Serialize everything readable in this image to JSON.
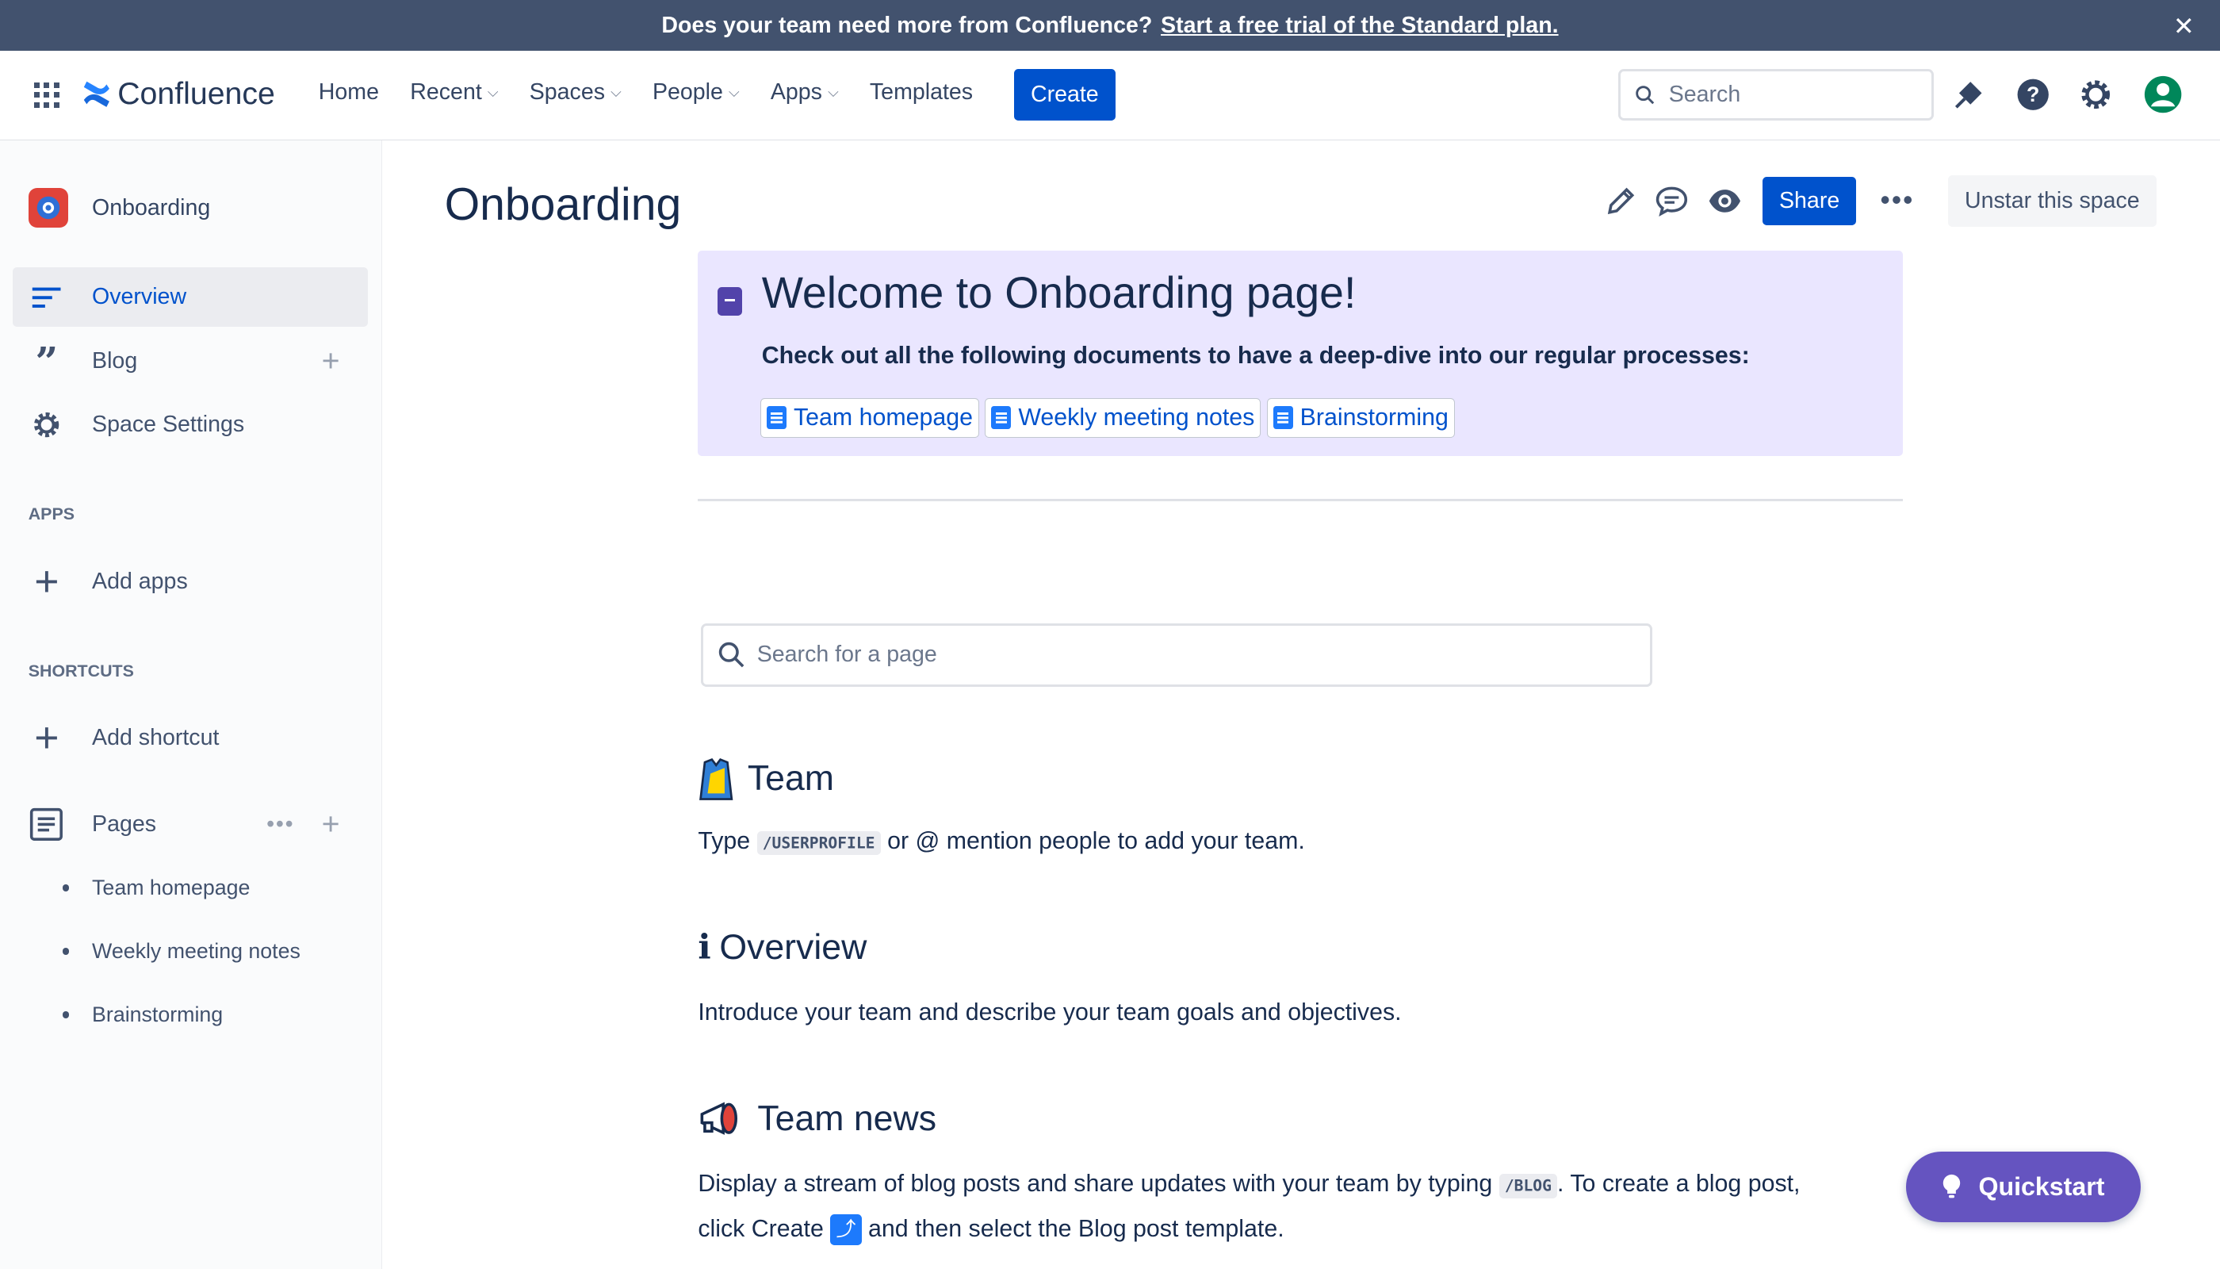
{
  "banner": {
    "text": "Does your team need more from Confluence?",
    "link": "Start a free trial of the Standard plan.",
    "close": "✕"
  },
  "nav": {
    "brand": "Confluence",
    "items": [
      {
        "label": "Home",
        "dropdown": false
      },
      {
        "label": "Recent",
        "dropdown": true
      },
      {
        "label": "Spaces",
        "dropdown": true
      },
      {
        "label": "People",
        "dropdown": true
      },
      {
        "label": "Apps",
        "dropdown": true
      },
      {
        "label": "Templates",
        "dropdown": false
      }
    ],
    "create": "Create",
    "search_placeholder": "Search"
  },
  "sidebar": {
    "space_name": "Onboarding",
    "overview": "Overview",
    "blog": "Blog",
    "space_settings": "Space Settings",
    "apps_label": "APPS",
    "add_apps": "Add apps",
    "shortcuts_label": "SHORTCUTS",
    "add_shortcut": "Add shortcut",
    "pages_label": "Pages",
    "pages": [
      "Team homepage",
      "Weekly meeting notes",
      "Brainstorming"
    ]
  },
  "main": {
    "title": "Onboarding",
    "share": "Share",
    "unstar": "Unstar this space",
    "panel": {
      "title": "Welcome to Onboarding page!",
      "subtitle": "Check out all the following documents to have a deep-dive into our regular processes:",
      "links": [
        "Team homepage",
        "Weekly meeting notes",
        "Brainstorming"
      ]
    },
    "page_search_placeholder": "Search for a page",
    "team": {
      "heading": "Team",
      "pre": "Type",
      "code": "/USERPROFILE",
      "post": "or @ mention people to add your team."
    },
    "overview": {
      "heading": "Overview",
      "text": "Introduce your team and describe your team goals and objectives."
    },
    "news": {
      "heading": "Team news",
      "pre": "Display a stream of blog posts and share updates with your team by typing",
      "code": "/BLOG",
      "mid": ". To create a blog post,",
      "line2_pre": "click Create",
      "line2_post": "and then select the Blog post template."
    }
  },
  "quickstart": "Quickstart",
  "colors": {
    "primary": "#0052cc",
    "banner": "#42526e",
    "panel": "#eae6ff",
    "quickstart": "#6554c0"
  }
}
